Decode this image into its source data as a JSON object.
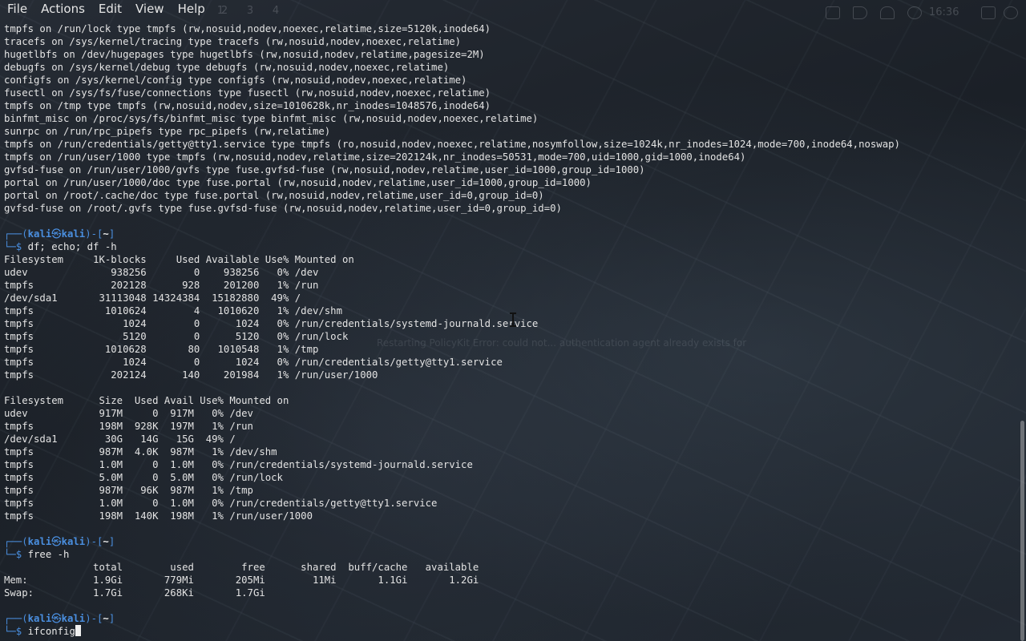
{
  "menu": [
    "File",
    "Actions",
    "Edit",
    "View",
    "Help"
  ],
  "panel": {
    "workspaces": [
      "1",
      "2",
      "3",
      "4"
    ],
    "clock": "16:36"
  },
  "prompt": {
    "user": "kali",
    "host": "kali",
    "dir": "~"
  },
  "mount_output": [
    "tmpfs on /run/lock type tmpfs (rw,nosuid,nodev,noexec,relatime,size=5120k,inode64)",
    "tracefs on /sys/kernel/tracing type tracefs (rw,nosuid,nodev,noexec,relatime)",
    "hugetlbfs on /dev/hugepages type hugetlbfs (rw,nosuid,nodev,relatime,pagesize=2M)",
    "debugfs on /sys/kernel/debug type debugfs (rw,nosuid,nodev,noexec,relatime)",
    "configfs on /sys/kernel/config type configfs (rw,nosuid,nodev,noexec,relatime)",
    "fusectl on /sys/fs/fuse/connections type fusectl (rw,nosuid,nodev,noexec,relatime)",
    "tmpfs on /tmp type tmpfs (rw,nosuid,nodev,size=1010628k,nr_inodes=1048576,inode64)",
    "binfmt_misc on /proc/sys/fs/binfmt_misc type binfmt_misc (rw,nosuid,nodev,noexec,relatime)",
    "sunrpc on /run/rpc_pipefs type rpc_pipefs (rw,relatime)",
    "tmpfs on /run/credentials/getty@tty1.service type tmpfs (ro,nosuid,nodev,noexec,relatime,nosymfollow,size=1024k,nr_inodes=1024,mode=700,inode64,noswap)",
    "tmpfs on /run/user/1000 type tmpfs (rw,nosuid,nodev,relatime,size=202124k,nr_inodes=50531,mode=700,uid=1000,gid=1000,inode64)",
    "gvfsd-fuse on /run/user/1000/gvfs type fuse.gvfsd-fuse (rw,nosuid,nodev,relatime,user_id=1000,group_id=1000)",
    "portal on /run/user/1000/doc type fuse.portal (rw,nosuid,nodev,relatime,user_id=1000,group_id=1000)",
    "portal on /root/.cache/doc type fuse.portal (rw,nosuid,nodev,relatime,user_id=0,group_id=0)",
    "gvfsd-fuse on /root/.gvfs type fuse.gvfsd-fuse (rw,nosuid,nodev,relatime,user_id=0,group_id=0)"
  ],
  "cmd1": "df; echo; df -h",
  "df_output": [
    "Filesystem     1K-blocks     Used Available Use% Mounted on",
    "udev              938256        0    938256   0% /dev",
    "tmpfs             202128      928    201200   1% /run",
    "/dev/sda1       31113048 14324384  15182880  49% /",
    "tmpfs            1010624        4   1010620   1% /dev/shm",
    "tmpfs               1024        0      1024   0% /run/credentials/systemd-journald.service",
    "tmpfs               5120        0      5120   0% /run/lock",
    "tmpfs            1010628       80   1010548   1% /tmp",
    "tmpfs               1024        0      1024   0% /run/credentials/getty@tty1.service",
    "tmpfs             202124      140    201984   1% /run/user/1000",
    "",
    "Filesystem      Size  Used Avail Use% Mounted on",
    "udev            917M     0  917M   0% /dev",
    "tmpfs           198M  928K  197M   1% /run",
    "/dev/sda1        30G   14G   15G  49% /",
    "tmpfs           987M  4.0K  987M   1% /dev/shm",
    "tmpfs           1.0M     0  1.0M   0% /run/credentials/systemd-journald.service",
    "tmpfs           5.0M     0  5.0M   0% /run/lock",
    "tmpfs           987M   96K  987M   1% /tmp",
    "tmpfs           1.0M     0  1.0M   0% /run/credentials/getty@tty1.service",
    "tmpfs           198M  140K  198M   1% /run/user/1000"
  ],
  "cmd2": "free -h",
  "free_output": [
    "               total        used        free      shared  buff/cache   available",
    "Mem:           1.9Gi       779Mi       205Mi        11Mi       1.1Gi       1.2Gi",
    "Swap:          1.7Gi       268Ki       1.7Gi"
  ],
  "cmd3": "ifconfig",
  "background_ghost_text": "Restarting PolicyKit Error: could not... authentication agent already exists for"
}
